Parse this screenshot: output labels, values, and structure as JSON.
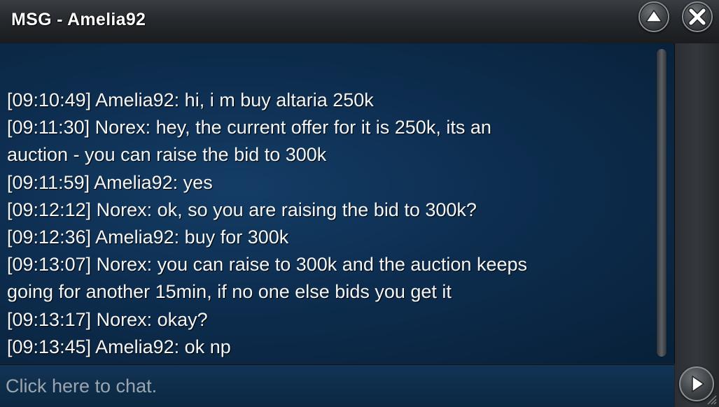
{
  "window": {
    "title": "MSG - Amelia92"
  },
  "controls": {
    "minimize_icon": "triangle-up-icon",
    "close_icon": "close-x-icon",
    "send_icon": "play-arrow-icon"
  },
  "messages": [
    "[09:10:49] Amelia92: hi, i m buy altaria 250k",
    "[09:11:30] Norex: hey, the current offer for it is 250k, its an",
    "auction - you can raise the bid to 300k",
    "[09:11:59] Amelia92: yes",
    "[09:12:12] Norex: ok, so you are raising the bid to 300k?",
    "[09:12:36] Amelia92: buy for 300k",
    "[09:13:07] Norex: you can raise to 300k and the auction keeps",
    "going for another 15min, if no one else bids you get it",
    "[09:13:17] Norex: okay?",
    "[09:13:45] Amelia92: ok np"
  ],
  "input": {
    "placeholder": "Click here to chat.",
    "value": ""
  },
  "colors": {
    "panel_bg": "#0d2d4f",
    "text": "#f4f6f8",
    "placeholder": "#9ba5ad",
    "chrome": "#2c2f33"
  }
}
